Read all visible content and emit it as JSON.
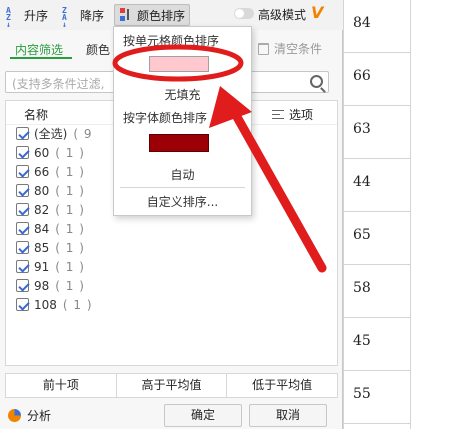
{
  "toolbar": {
    "sort_asc": "升序",
    "sort_desc": "降序",
    "sort_color": "颜色排序",
    "advanced_mode": "高级模式"
  },
  "tabs": {
    "content": "内容筛选",
    "color": "颜色",
    "partial": "选",
    "clear": "清空条件"
  },
  "search": {
    "placeholder": "(支持多条件过滤,"
  },
  "list": {
    "header": "名称",
    "options": "选项",
    "items": [
      {
        "label": "(全选)",
        "count": "( 9"
      },
      {
        "label": "60",
        "count": "( 1 )"
      },
      {
        "label": "66",
        "count": "( 1 )"
      },
      {
        "label": "80",
        "count": "( 1 )"
      },
      {
        "label": "82",
        "count": "( 1 )"
      },
      {
        "label": "84",
        "count": "( 1 )"
      },
      {
        "label": "85",
        "count": "( 1 )"
      },
      {
        "label": "91",
        "count": "( 1 )"
      },
      {
        "label": "98",
        "count": "( 1 )"
      },
      {
        "label": "108",
        "count": "( 1 )"
      }
    ]
  },
  "quick_filters": [
    "前十项",
    "高于平均值",
    "低于平均值"
  ],
  "footer": {
    "analysis": "分析",
    "ok": "确定",
    "cancel": "取消"
  },
  "dropdown": {
    "cell_color_heading": "按单元格颜色排序",
    "no_fill": "无填充",
    "font_color_heading": "按字体颜色排序",
    "auto": "自动",
    "custom_sort": "自定义排序..."
  },
  "sheet": {
    "values": [
      "84",
      "66",
      "63",
      "44",
      "65",
      "58",
      "45",
      "55"
    ]
  },
  "colors": {
    "accent_green": "#2a9d3e",
    "cell_fill_pink": "#ffc7ce",
    "font_dark_red": "#9c0006",
    "annotation_red": "#e01c1c",
    "brand_orange": "#f08300"
  },
  "icons": [
    "sort-asc-icon",
    "sort-desc-icon",
    "color-sort-icon",
    "toggle",
    "wps-v-icon",
    "trash-icon",
    "search-icon",
    "options-icon",
    "pie-chart-icon"
  ]
}
